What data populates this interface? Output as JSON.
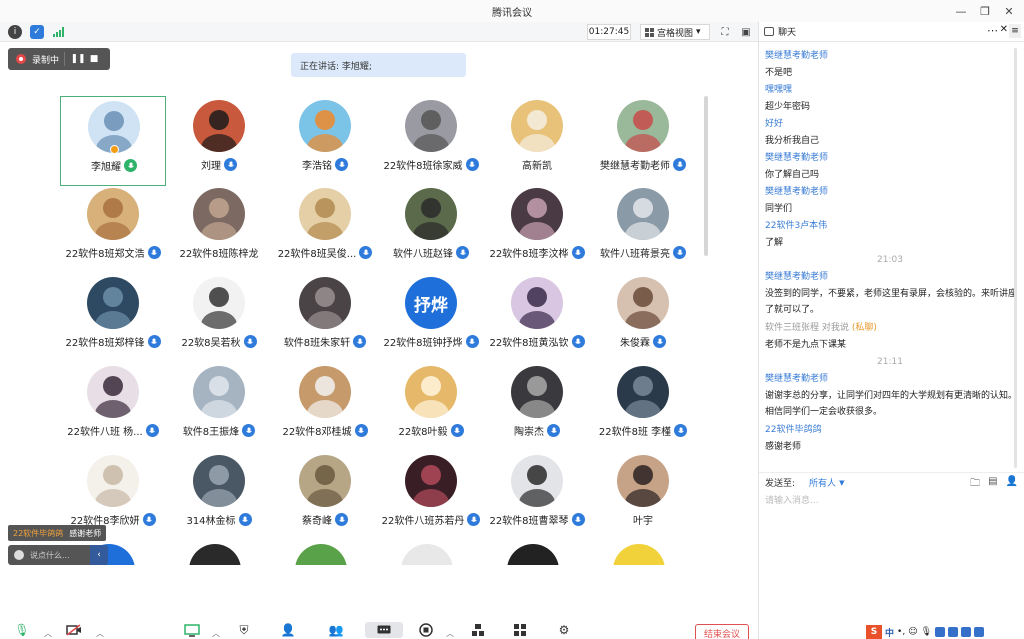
{
  "window": {
    "title": "腾讯会议",
    "minimize": "—",
    "restore": "❐",
    "close": "✕"
  },
  "toolbar": {
    "timer": "01:27:45",
    "view_label": "宫格视图",
    "view_caret": "▾"
  },
  "recording": {
    "label": "录制中"
  },
  "speaking": {
    "text": "正在讲话: 李旭耀;"
  },
  "participants": [
    {
      "name": "李旭耀",
      "mic": "green",
      "active": true,
      "avatar_bg": "#cfe3f4",
      "avatar_fg": "#6a8fb5"
    },
    {
      "name": "刘理",
      "mic": "blue",
      "avatar_bg": "#c9593c",
      "avatar_fg": "#1b1b1b"
    },
    {
      "name": "李浩铭",
      "mic": "blue",
      "avatar_bg": "#7cc3e8",
      "avatar_fg": "#f08a2a"
    },
    {
      "name": "22软件8班徐家威",
      "mic": "blue",
      "avatar_bg": "#9a9aa2",
      "avatar_fg": "#555"
    },
    {
      "name": "高新凯",
      "mic": "",
      "avatar_bg": "#e9c27a",
      "avatar_fg": "#f4eee0"
    },
    {
      "name": "樊继慧考勤老师",
      "mic": "blue",
      "avatar_bg": "#9ab89a",
      "avatar_fg": "#c84a4a"
    },
    {
      "name": "22软件8班郑文浩",
      "mic": "blue",
      "avatar_bg": "#d8b07a",
      "avatar_fg": "#a87040"
    },
    {
      "name": "22软件8班陈梓龙",
      "mic": "",
      "avatar_bg": "#7c6a62",
      "avatar_fg": "#c2a690"
    },
    {
      "name": "22软件8班吴俊...",
      "mic": "blue",
      "avatar_bg": "#e4cfa6",
      "avatar_fg": "#b38a50"
    },
    {
      "name": "软件八班赵锋",
      "mic": "blue",
      "avatar_bg": "#5a6a4a",
      "avatar_fg": "#2a2a2a"
    },
    {
      "name": "22软件8班李汶桦",
      "mic": "blue",
      "avatar_bg": "#4a3a44",
      "avatar_fg": "#c6a0b0"
    },
    {
      "name": "软件八班蒋景亮",
      "mic": "blue",
      "avatar_bg": "#8a9aa6",
      "avatar_fg": "#e2e6ea"
    },
    {
      "name": "22软件8班郑梓锋",
      "mic": "blue",
      "avatar_bg": "#2d4a62",
      "avatar_fg": "#6d8ea8"
    },
    {
      "name": "22软8吴若秋",
      "mic": "blue",
      "avatar_bg": "#f2f2f2",
      "avatar_fg": "#333"
    },
    {
      "name": "软件8班朱家轩",
      "mic": "blue",
      "avatar_bg": "#4a4446",
      "avatar_fg": "#9a9092"
    },
    {
      "name": "22软件8班钟抒烨",
      "mic": "blue",
      "avatar_bg": "#1e6fd9",
      "avatar_fg": "#ffffff",
      "text_avatar": "抒烨"
    },
    {
      "name": "22软件8班黄泓钦",
      "mic": "blue",
      "avatar_bg": "#d8c6e2",
      "avatar_fg": "#3a2a4a"
    },
    {
      "name": "朱俊霖",
      "mic": "blue",
      "avatar_bg": "#d6c0b0",
      "avatar_fg": "#6a4a3a"
    },
    {
      "name": "22软件八班 杨...",
      "mic": "blue",
      "avatar_bg": "#e8dfe6",
      "avatar_fg": "#3a2a3a"
    },
    {
      "name": "软件8王振烽",
      "mic": "blue",
      "avatar_bg": "#a6b4c2",
      "avatar_fg": "#e0e6ec"
    },
    {
      "name": "22软件8邓桂城",
      "mic": "blue",
      "avatar_bg": "#c69a6a",
      "avatar_fg": "#f2f2f2"
    },
    {
      "name": "22软8叶毅",
      "mic": "blue",
      "avatar_bg": "#e6b86a",
      "avatar_fg": "#fff4dc"
    },
    {
      "name": "陶崇杰",
      "mic": "blue",
      "avatar_bg": "#3a3a3e",
      "avatar_fg": "#aaa"
    },
    {
      "name": "22软件8班 李槿",
      "mic": "blue",
      "avatar_bg": "#2a3a4a",
      "avatar_fg": "#7a8a9a"
    },
    {
      "name": "22软件8李欣妍",
      "mic": "blue",
      "avatar_bg": "#f4f0ea",
      "avatar_fg": "#c8b8a6"
    },
    {
      "name": "314林金标",
      "mic": "blue",
      "avatar_bg": "#4a5866",
      "avatar_fg": "#9aa6b2"
    },
    {
      "name": "蔡奇峰",
      "mic": "blue",
      "avatar_bg": "#b6a686",
      "avatar_fg": "#6a5a40"
    },
    {
      "name": "22软件八班苏若丹",
      "mic": "blue",
      "avatar_bg": "#3a1e26",
      "avatar_fg": "#b24a5a"
    },
    {
      "name": "22软件8班曹翠琴",
      "mic": "blue",
      "avatar_bg": "#e2e4e8",
      "avatar_fg": "#2a2a2a"
    },
    {
      "name": "叶宇",
      "mic": "",
      "avatar_bg": "#c6a286",
      "avatar_fg": "#2a2222"
    }
  ],
  "chat_preview": {
    "sender": "22软件毕鸽鸽",
    "message": "感谢老师"
  },
  "say_box": {
    "placeholder": "说点什么..."
  },
  "chat": {
    "header_title": "聊天",
    "messages": [
      {
        "kind": "sender",
        "text": "樊继慧考勤老师"
      },
      {
        "kind": "text",
        "text": "不是吧"
      },
      {
        "kind": "sender",
        "text": "嘿嘿嘿"
      },
      {
        "kind": "text",
        "text": "超少年密码"
      },
      {
        "kind": "sender",
        "text": "好好"
      },
      {
        "kind": "text",
        "text": "我分析我自己"
      },
      {
        "kind": "sender",
        "text": "樊继慧考勤老师"
      },
      {
        "kind": "text",
        "text": "你了解自己吗"
      },
      {
        "kind": "sender",
        "text": "樊继慧考勤老师"
      },
      {
        "kind": "text",
        "text": "同学们"
      },
      {
        "kind": "sender",
        "text": "22软件3卢本伟"
      },
      {
        "kind": "text",
        "text": "了解"
      },
      {
        "kind": "time",
        "text": "21:03"
      },
      {
        "kind": "sender",
        "text": "樊继慧考勤老师"
      },
      {
        "kind": "wrap",
        "text": "没签到的同学，不要紧，老师这里有录屏，会核验的。来听讲座了就可以了。"
      },
      {
        "kind": "private",
        "text": "软件三班张程 对我说",
        "tag": "(私聊)"
      },
      {
        "kind": "text",
        "text": "老师不是九点下课某"
      },
      {
        "kind": "time",
        "text": "21:11"
      },
      {
        "kind": "sender",
        "text": "樊继慧考勤老师"
      },
      {
        "kind": "wrap",
        "text": "谢谢李总的分享，让同学们对四年的大学规划有更清晰的认知。相信同学们一定会收获很多。"
      },
      {
        "kind": "sender",
        "text": "22软件毕鸽鸽"
      },
      {
        "kind": "text",
        "text": "感谢老师"
      }
    ],
    "send_to_label": "发送至:",
    "send_to_value": "所有人",
    "input_placeholder": "请输入消息..."
  },
  "end_meeting": "结束会议",
  "colors": {
    "accent": "#2f7bdc",
    "active_border": "#4caf7a",
    "end": "#e05050"
  }
}
